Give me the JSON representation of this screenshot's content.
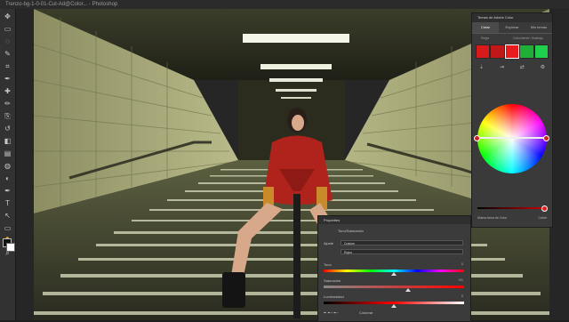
{
  "window": {
    "title": "Trenzo-bg-1-0-01-Cut-Ad@Color... - Photoshop"
  },
  "toolbar": {
    "tools": [
      "move-tool",
      "marquee-tool",
      "lasso-tool",
      "quick-select-tool",
      "crop-tool",
      "eyedropper-tool",
      "healing-tool",
      "brush-tool",
      "clone-tool",
      "history-brush-tool",
      "eraser-tool",
      "gradient-tool",
      "blur-tool",
      "dodge-tool",
      "pen-tool",
      "type-tool",
      "path-select-tool",
      "shape-tool",
      "hand-tool",
      "zoom-tool"
    ],
    "tool_glyphs": [
      "✥",
      "▭",
      "◌",
      "✎",
      "⌗",
      "✒",
      "✚",
      "✏",
      "⎘",
      "↺",
      "◧",
      "▤",
      "◍",
      "◐",
      "✒",
      "T",
      "↖",
      "▭",
      "✋",
      "⌕"
    ]
  },
  "color_panel": {
    "title": "Temas de Adobe Color",
    "tabs": [
      "Crear",
      "Explorar",
      "Mis temas"
    ],
    "sub_left": "Regla",
    "sub_right": "Coincidente / Análogo",
    "swatches": [
      "#d81a1a",
      "#c01818",
      "#e81c1c",
      "#1fae36",
      "#1fd04a"
    ],
    "selected_swatch": 2,
    "footer_label": "Mismo tema de Color",
    "footer_button": "Cubrir"
  },
  "properties": {
    "title": "Properties",
    "layer_label": "Tono/Saturación",
    "preset_label": "Ajuste",
    "preset_value": "Custom",
    "channel_value": "Rojos",
    "sliders": [
      {
        "label": "Tono",
        "value": "0",
        "fraction": 0.5
      },
      {
        "label": "Saturación",
        "value": "+21",
        "fraction": 0.6
      },
      {
        "label": "Luminosidad",
        "value": "0",
        "fraction": 0.5
      }
    ],
    "colorize_label": "Colorear"
  },
  "colors": {
    "accent": "#d81a1a",
    "panel_bg": "#3a3a3a",
    "app_bg": "#1e1e1e"
  }
}
